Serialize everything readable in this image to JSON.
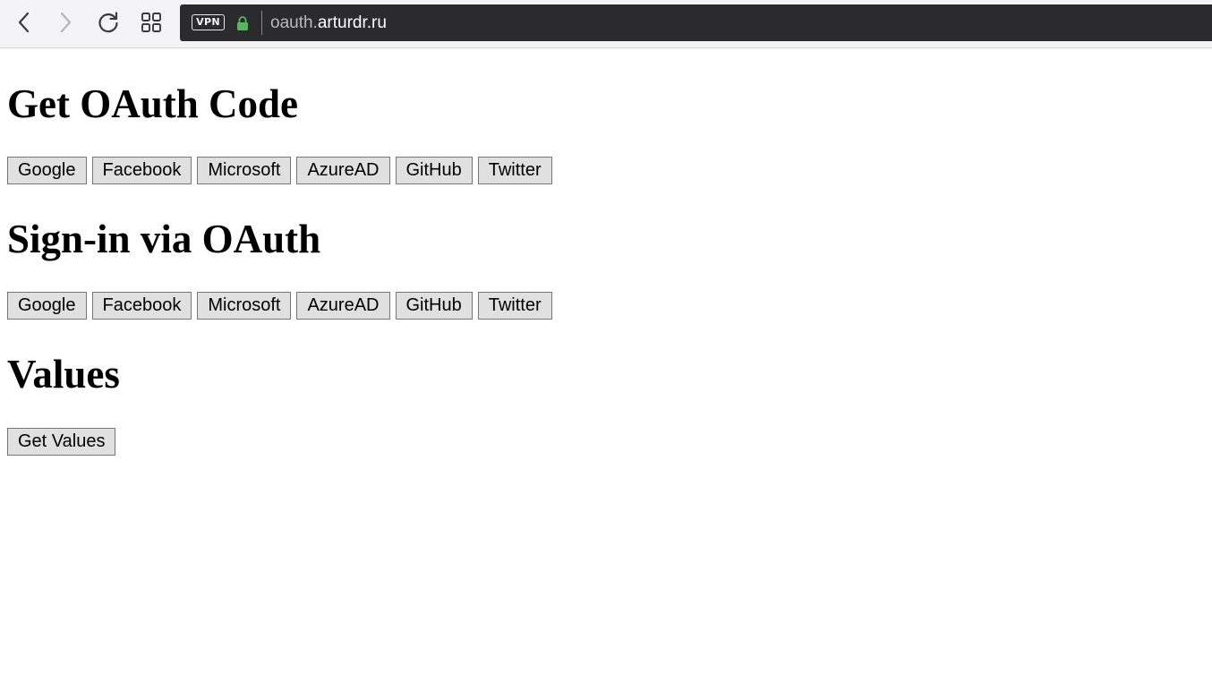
{
  "browser": {
    "vpn_label": "VPN",
    "url_subdomain": "oauth.",
    "url_domain": "arturdr.ru",
    "icons": {
      "back": "back-arrow-icon",
      "forward": "forward-arrow-icon",
      "reload": "reload-icon",
      "tabs": "tabs-grid-icon",
      "lock": "lock-icon"
    },
    "colors": {
      "address_bar": "#2b2b2d",
      "lock": "#57b55f"
    }
  },
  "sections": {
    "code": {
      "title": "Get OAuth Code",
      "buttons": [
        "Google",
        "Facebook",
        "Microsoft",
        "AzureAD",
        "GitHub",
        "Twitter"
      ]
    },
    "signin": {
      "title": "Sign-in via OAuth",
      "buttons": [
        "Google",
        "Facebook",
        "Microsoft",
        "AzureAD",
        "GitHub",
        "Twitter"
      ]
    },
    "values": {
      "title": "Values",
      "buttons": [
        "Get Values"
      ]
    }
  }
}
